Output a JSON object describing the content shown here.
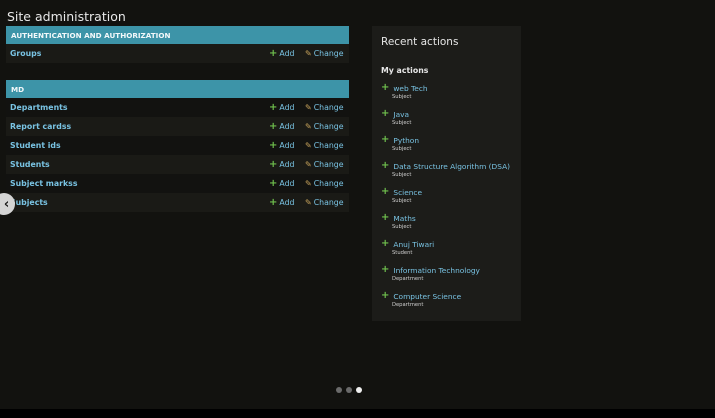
{
  "page": {
    "title": "Site administration"
  },
  "modules": [
    {
      "header": "Authentication and Authorization",
      "rows": [
        {
          "name": "Groups"
        }
      ]
    },
    {
      "header": "MD",
      "rows": [
        {
          "name": "Departments"
        },
        {
          "name": "Report cardss"
        },
        {
          "name": "Student ids"
        },
        {
          "name": "Students"
        },
        {
          "name": "Subject markss"
        },
        {
          "name": "Subjects"
        }
      ]
    }
  ],
  "links": {
    "add": "Add",
    "change": "Change"
  },
  "recent": {
    "title": "Recent actions",
    "my_actions": "My actions",
    "items": [
      {
        "name": "web Tech",
        "type": "Subject"
      },
      {
        "name": "Java",
        "type": "Subject"
      },
      {
        "name": "Python",
        "type": "Subject"
      },
      {
        "name": "Data Structure Algorithm (DSA)",
        "type": "Subject"
      },
      {
        "name": "Science",
        "type": "Subject"
      },
      {
        "name": "Maths",
        "type": "Subject"
      },
      {
        "name": "Anuj Tiwari",
        "type": "Student"
      },
      {
        "name": "Information Technology",
        "type": "Department"
      },
      {
        "name": "Computer Science",
        "type": "Department"
      }
    ]
  },
  "icons": {
    "add": "plus-icon",
    "change": "pencil-icon",
    "prev": "chevron-left-icon"
  },
  "colors": {
    "header": "#3d94a8",
    "link": "#79c3e3",
    "add_icon": "#6fbf4d",
    "background": "#12120f"
  },
  "carousel": {
    "slide_count": 3,
    "active_index": 2
  }
}
